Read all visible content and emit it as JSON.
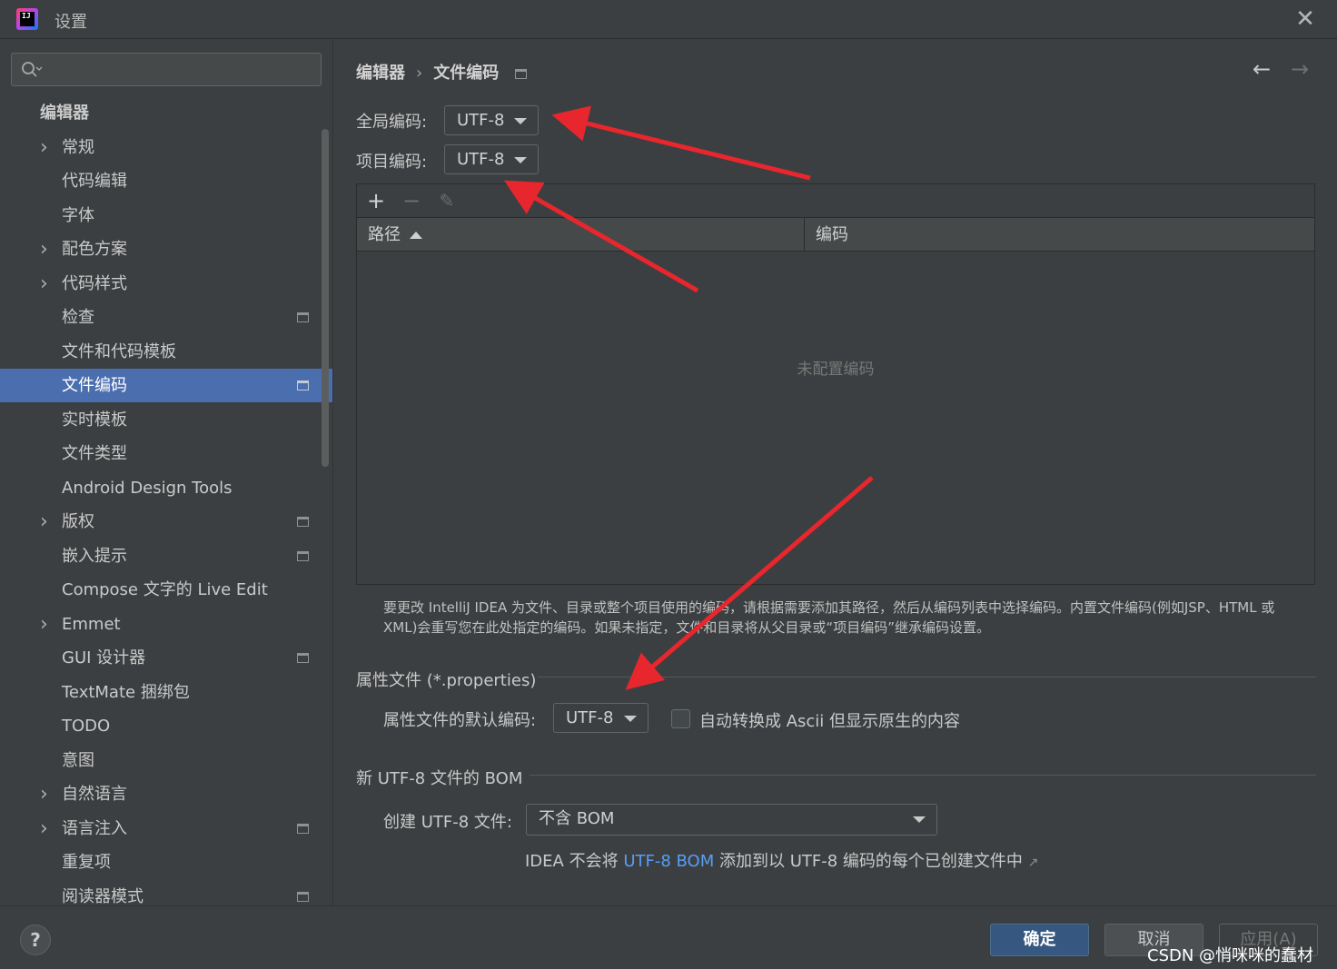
{
  "window": {
    "title": "设置",
    "close_glyph": "✕",
    "logo_text": "IJ"
  },
  "search": {
    "placeholder": "",
    "value": ""
  },
  "sidebar": {
    "items": [
      {
        "label": "编辑器",
        "header": true
      },
      {
        "label": "常规",
        "expandable": true
      },
      {
        "label": "代码编辑"
      },
      {
        "label": "字体"
      },
      {
        "label": "配色方案",
        "expandable": true
      },
      {
        "label": "代码样式",
        "expandable": true
      },
      {
        "label": "检查",
        "badge": true
      },
      {
        "label": "文件和代码模板"
      },
      {
        "label": "文件编码",
        "badge": true,
        "selected": true
      },
      {
        "label": "实时模板"
      },
      {
        "label": "文件类型"
      },
      {
        "label": "Android Design Tools"
      },
      {
        "label": "版权",
        "expandable": true,
        "badge": true
      },
      {
        "label": "嵌入提示",
        "badge": true
      },
      {
        "label": "Compose 文字的 Live Edit"
      },
      {
        "label": "Emmet",
        "expandable": true
      },
      {
        "label": "GUI 设计器",
        "badge": true
      },
      {
        "label": "TextMate 捆绑包"
      },
      {
        "label": "TODO"
      },
      {
        "label": "意图"
      },
      {
        "label": "自然语言",
        "expandable": true
      },
      {
        "label": "语言注入",
        "expandable": true,
        "badge": true
      },
      {
        "label": "重复项"
      },
      {
        "label": "阅读器模式",
        "badge": true
      }
    ]
  },
  "breadcrumb": {
    "parent": "编辑器",
    "separator": "›",
    "current": "文件编码"
  },
  "nav": {
    "back": "←",
    "forward": "→"
  },
  "encoding": {
    "global_label": "全局编码:",
    "global_value": "UTF-8",
    "project_label": "项目编码:",
    "project_value": "UTF-8"
  },
  "table": {
    "toolbar": {
      "add": "+",
      "remove": "−",
      "edit": "✎"
    },
    "columns": [
      "路径",
      "编码"
    ],
    "sorted_column": "路径",
    "sort_direction": "ascending",
    "rows": [],
    "empty_text": "未配置编码"
  },
  "help_text": "要更改 IntelliJ IDEA 为文件、目录或整个项目使用的编码，请根据需要添加其路径，然后从编码列表中选择编码。内置文件编码(例如JSP、HTML 或 XML)会重写您在此处指定的编码。如果未指定，文件和目录将从父目录或“项目编码”继承编码设置。",
  "properties": {
    "section_title": "属性文件 (*.properties)",
    "default_label": "属性文件的默认编码:",
    "default_value": "UTF-8",
    "ascii_checkbox_label": "自动转换成 Ascii 但显示原生的内容",
    "ascii_checked": false
  },
  "bom": {
    "section_title": "新 UTF-8 文件的 BOM",
    "create_label": "创建 UTF-8 文件:",
    "create_value": "不含 BOM",
    "note_prefix": "IDEA 不会将 ",
    "note_link": "UTF-8 BOM",
    "note_suffix": " 添加到以 UTF-8 编码的每个已创建文件中",
    "external_glyph": "↗"
  },
  "buttons": {
    "help": "?",
    "ok": "确定",
    "cancel": "取消",
    "apply": "应用(A)"
  },
  "watermark": "CSDN @悄咪咪的蠢材",
  "annotation_color": "#e8262d"
}
